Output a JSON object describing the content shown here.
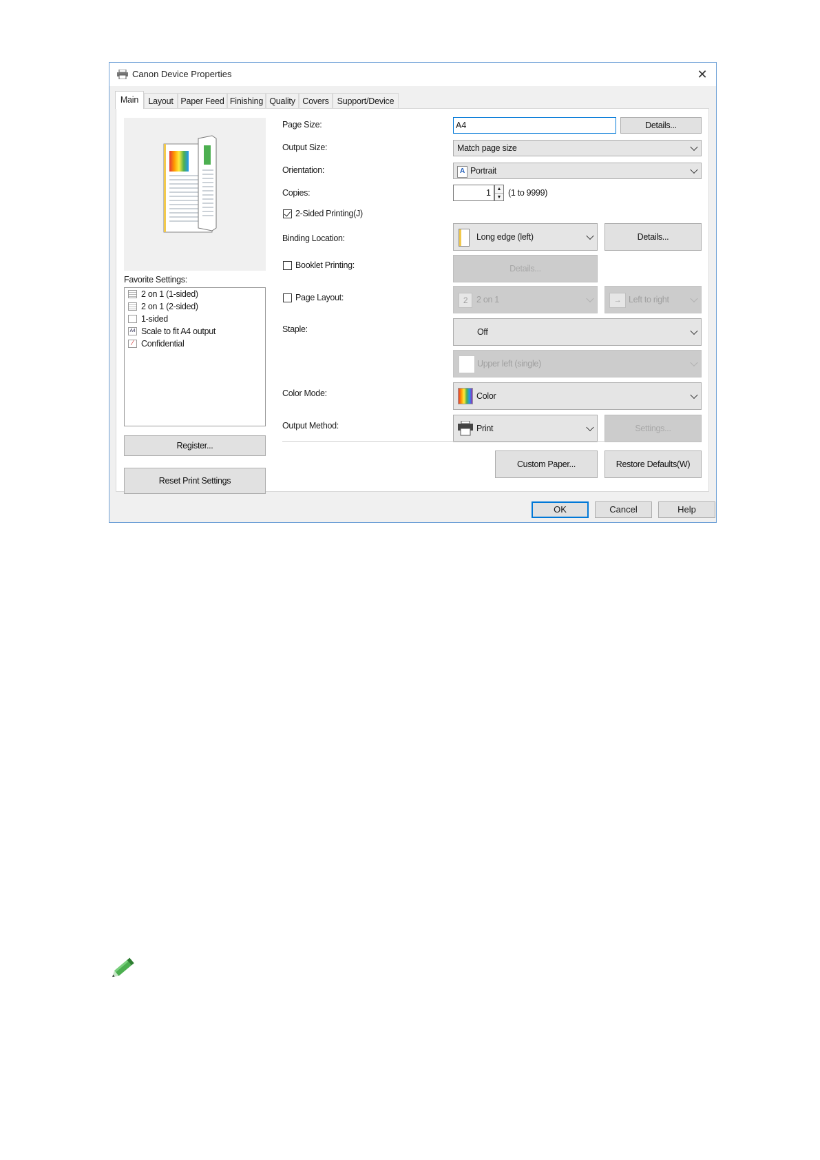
{
  "window": {
    "title": "Canon Device Properties"
  },
  "tabs": [
    {
      "label": "Main"
    },
    {
      "label": "Layout"
    },
    {
      "label": "Paper Feed"
    },
    {
      "label": "Finishing"
    },
    {
      "label": "Quality"
    },
    {
      "label": "Covers"
    },
    {
      "label": "Support/Device"
    }
  ],
  "favorites": {
    "label": "Favorite Settings:",
    "items": [
      {
        "label": "2 on 1 (1-sided)",
        "icon": "two-on-one-icon"
      },
      {
        "label": "2 on 1 (2-sided)",
        "icon": "two-on-one-duplex-icon"
      },
      {
        "label": "1-sided",
        "icon": "one-sided-icon"
      },
      {
        "label": "Scale to fit A4 output",
        "icon": "a4-icon"
      },
      {
        "label": "Confidential",
        "icon": "confidential-icon"
      }
    ],
    "register_button": "Register...",
    "reset_button": "Reset Print Settings"
  },
  "form": {
    "page_size_label": "Page Size:",
    "page_size_value": "A4",
    "page_size_details": "Details...",
    "output_size_label": "Output Size:",
    "output_size_value": "Match page size",
    "orientation_label": "Orientation:",
    "orientation_value": "Portrait",
    "orientation_icon_glyph": "A",
    "copies_label": "Copies:",
    "copies_value": "1",
    "copies_range": "(1 to 9999)",
    "two_sided_label": "2-Sided Printing(J)",
    "two_sided_checked": true,
    "binding_label": "Binding Location:",
    "binding_value": "Long edge (left)",
    "binding_details": "Details...",
    "booklet_label": "Booklet Printing:",
    "booklet_checked": false,
    "booklet_details": "Details...",
    "page_layout_label": "Page Layout:",
    "page_layout_checked": false,
    "page_layout_value": "2 on 1",
    "page_layout_icon_glyph": "2",
    "page_order_value": "Left to right",
    "staple_label": "Staple:",
    "staple_value": "Off",
    "staple_position_value": "Upper left (single)",
    "color_mode_label": "Color Mode:",
    "color_mode_value": "Color",
    "output_method_label": "Output Method:",
    "output_method_value": "Print",
    "output_method_settings": "Settings...",
    "custom_paper_button": "Custom Paper...",
    "restore_defaults_button": "Restore Defaults(W)"
  },
  "dialog_buttons": {
    "ok": "OK",
    "cancel": "Cancel",
    "help": "Help"
  },
  "colors": {
    "accent": "#0078d7",
    "window_border": "#6c9fd6",
    "pencil": "#4caf50"
  }
}
